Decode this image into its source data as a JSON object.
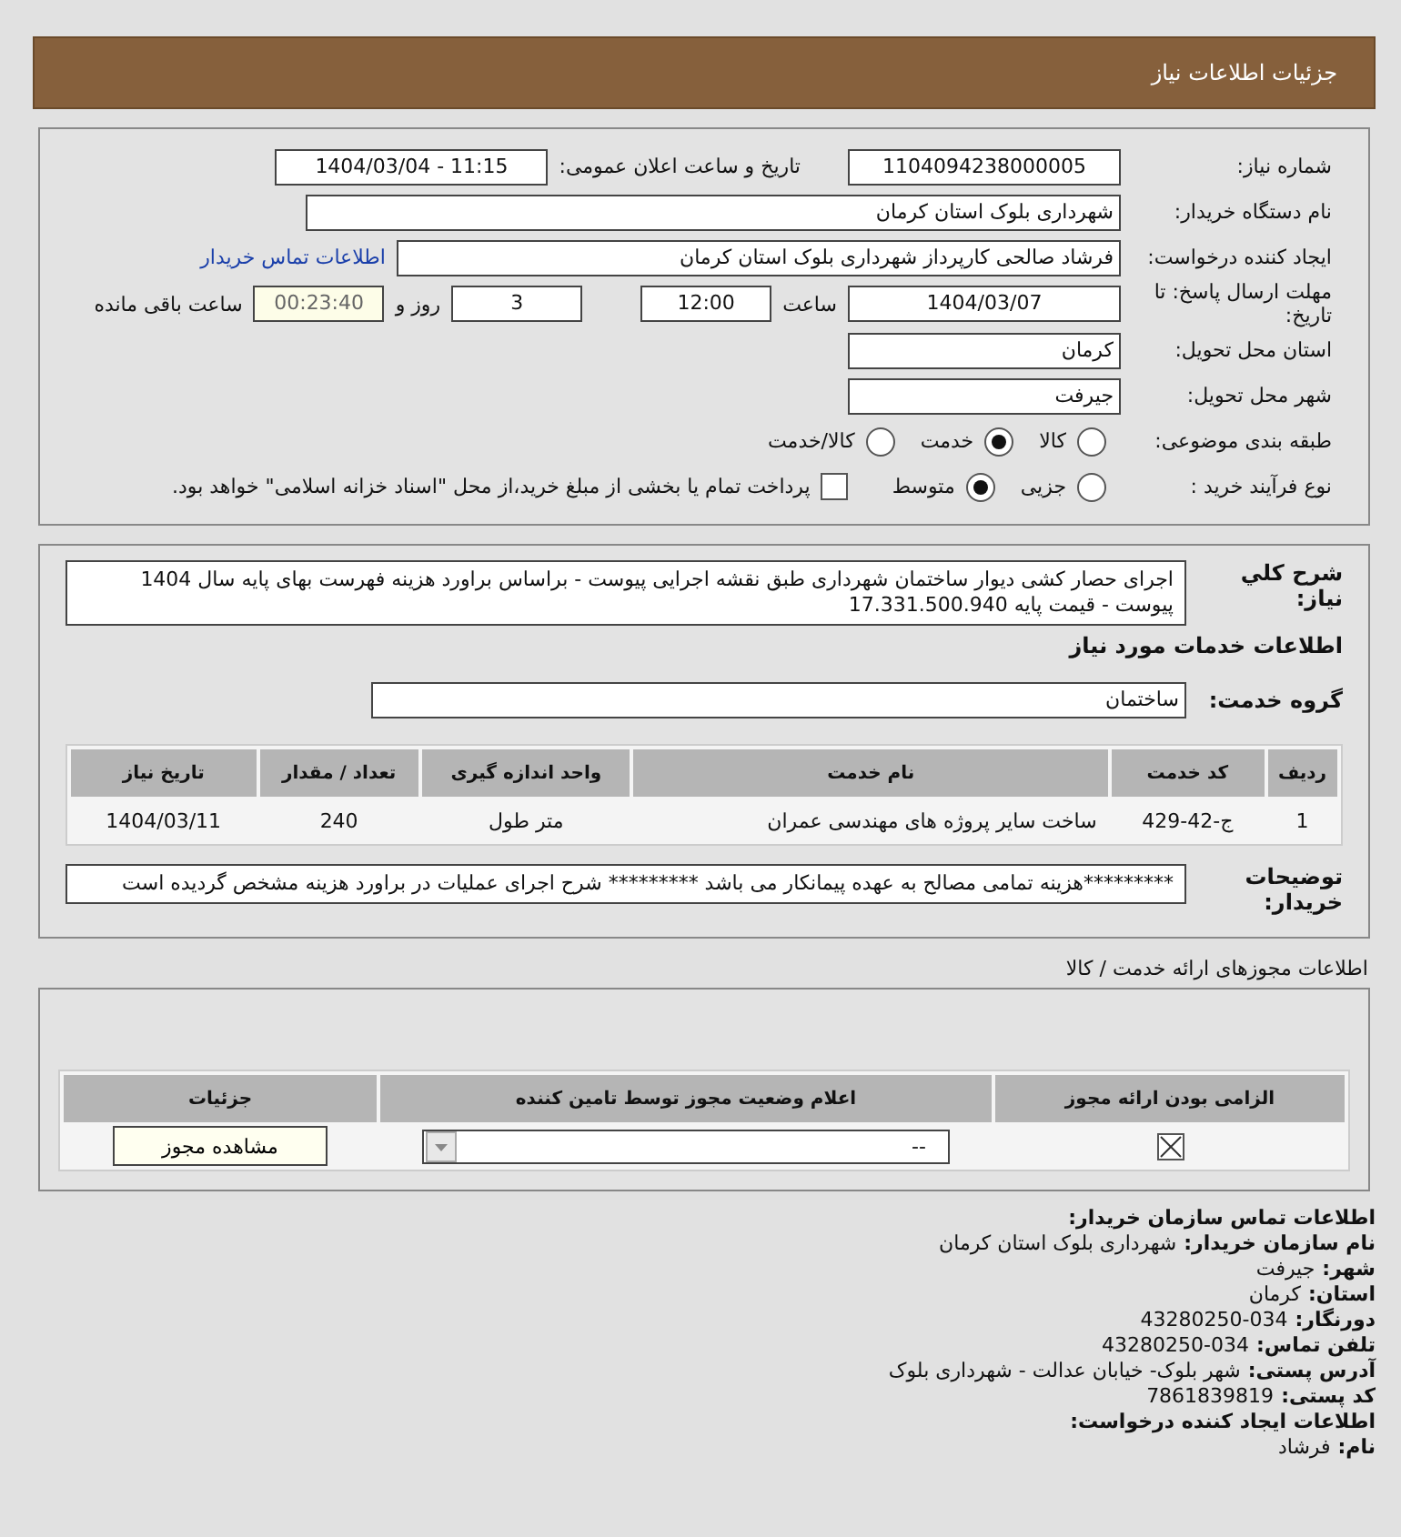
{
  "header": {
    "title": "جزئیات اطلاعات نیاز"
  },
  "need_number": {
    "label": "شماره نیاز:",
    "value": "1104094238000005"
  },
  "announce": {
    "label": "تاریخ و ساعت اعلان عمومی:",
    "value": "1404/03/04 - 11:15"
  },
  "buyer_org": {
    "label": "نام دستگاه خریدار:",
    "value": "شهرداری بلوک استان کرمان"
  },
  "requester": {
    "label": "ایجاد کننده درخواست:",
    "value": "فرشاد صالحی کارپرداز شهرداری بلوک استان کرمان",
    "link": "اطلاعات تماس خریدار"
  },
  "deadline": {
    "label": "مهلت ارسال پاسخ: تا تاریخ:",
    "date": "1404/03/07",
    "time_label": "ساعت",
    "time": "12:00",
    "days": "3",
    "days_label": "روز و",
    "remaining": "00:23:40",
    "remaining_label": "ساعت باقی مانده"
  },
  "province": {
    "label": "استان محل تحویل:",
    "value": "کرمان"
  },
  "city": {
    "label": "شهر محل تحویل:",
    "value": "جیرفت"
  },
  "category": {
    "label": "طبقه بندی موضوعی:",
    "options": [
      {
        "label": "کالا",
        "selected": false
      },
      {
        "label": "خدمت",
        "selected": true
      },
      {
        "label": "کالا/خدمت",
        "selected": false
      }
    ]
  },
  "process": {
    "label": "نوع فرآیند خرید :",
    "options": [
      {
        "label": "جزیی",
        "selected": false
      },
      {
        "label": "متوسط",
        "selected": true
      }
    ],
    "payment": {
      "label": "پرداخت تمام یا بخشی از مبلغ خرید،از محل \"اسناد خزانه اسلامی\" خواهد بود.",
      "checked": false
    }
  },
  "summary": {
    "label": "شرح کلي نیاز:",
    "value": "اجرای حصار کشی دیوار ساختمان شهرداری طبق نقشه اجرایی پیوست - براساس براورد هزینه فهرست بهای پایه سال 1404 پیوست - قیمت پایه 17.331.500.940"
  },
  "services_title": "اطلاعات خدمات مورد نیاز",
  "service_group": {
    "label": "گروه خدمت:",
    "value": "ساختمان"
  },
  "services_table": {
    "columns": [
      "ردیف",
      "کد خدمت",
      "نام خدمت",
      "واحد اندازه گیری",
      "تعداد / مقدار",
      "تاریخ نیاز"
    ],
    "rows": [
      [
        "1",
        "ج-42-429",
        "ساخت سایر پروژه های مهندسی عمران",
        "متر طول",
        "240",
        "1404/03/11"
      ]
    ]
  },
  "buyer_notes": {
    "label": "توضیحات خریدار:",
    "value": "*********هزینه تمامی مصالح به عهده پیمانکار می باشد ********* شرح اجرای عملیات در براورد هزینه مشخص گردیده است"
  },
  "permits": {
    "title": "اطلاعات مجوزهای ارائه خدمت / کالا",
    "columns": [
      "الزامی بودن ارائه مجوز",
      "اعلام وضعیت مجوز توسط تامین کننده",
      "جزئیات"
    ],
    "rows": [
      {
        "required": true,
        "status": "--",
        "button": "مشاهده مجوز"
      }
    ]
  },
  "contact": [
    {
      "label": "اطلاعات تماس سازمان خریدار:"
    },
    {
      "label": "نام سازمان خریدار:",
      "value": "شهرداری بلوک استان کرمان"
    },
    {
      "label": "شهر:",
      "value": "جیرفت"
    },
    {
      "label": "استان:",
      "value": "کرمان"
    },
    {
      "label": "دورنگار:",
      "value": "034-43280250"
    },
    {
      "label": "تلفن تماس:",
      "value": "034-43280250"
    },
    {
      "label": "آدرس پستی:",
      "value": "شهر بلوک- خیابان عدالت - شهرداری بلوک"
    },
    {
      "label": "کد پستی:",
      "value": "7861839819"
    },
    {
      "label": "اطلاعات ایجاد کننده درخواست:"
    },
    {
      "label": "نام:",
      "value": "فرشاد"
    }
  ]
}
